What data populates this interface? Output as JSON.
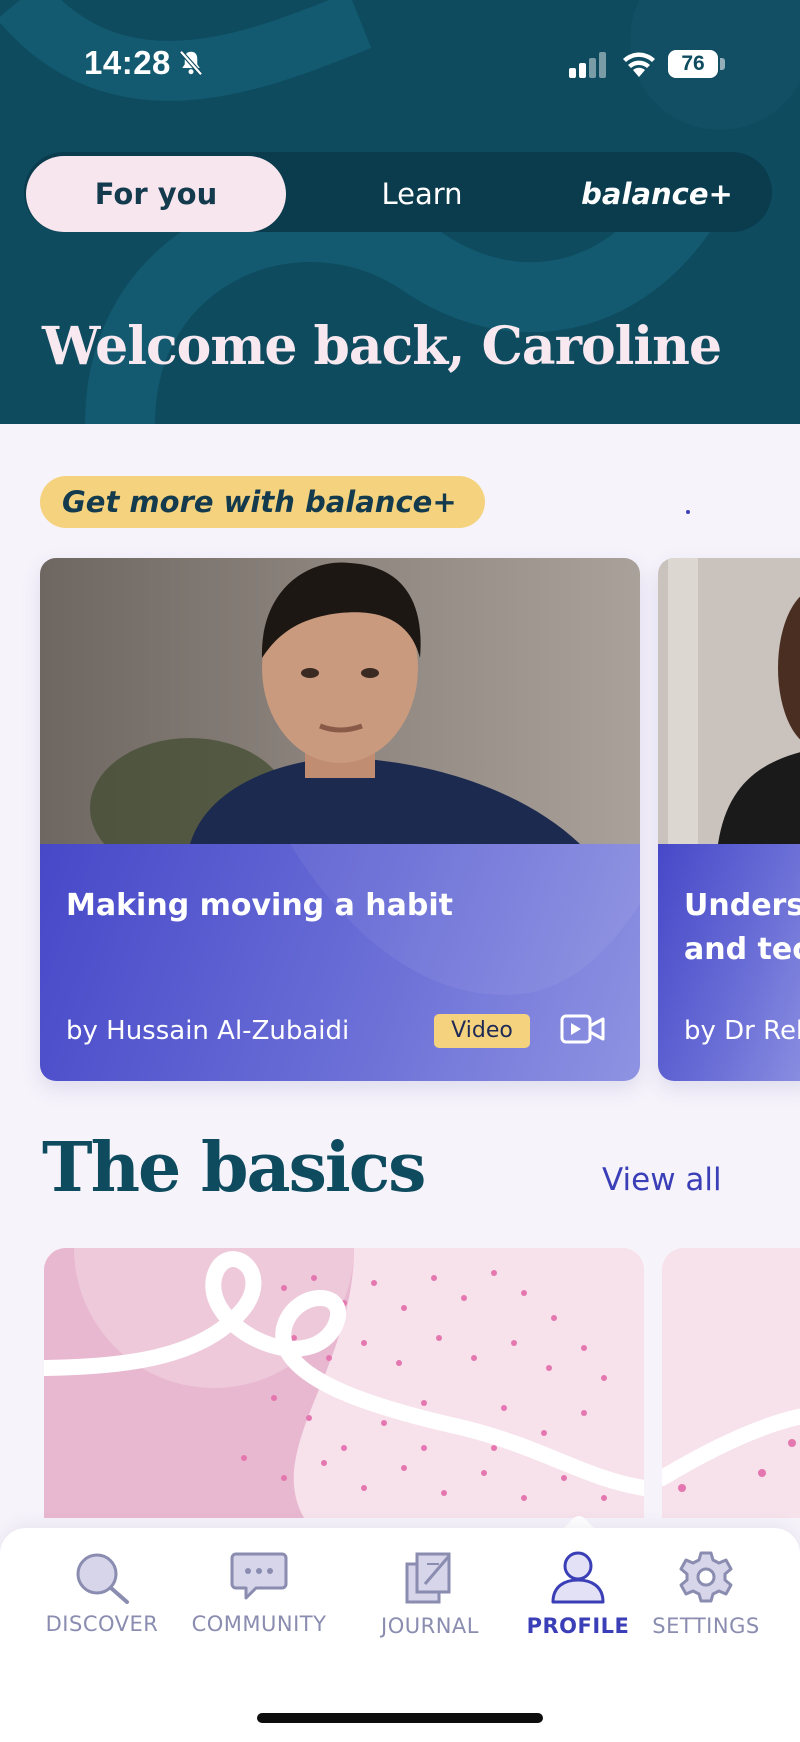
{
  "status_bar": {
    "time": "14:28",
    "battery": "76"
  },
  "tabs": [
    {
      "label": "For you",
      "active": true
    },
    {
      "label": "Learn",
      "active": false
    },
    {
      "label": "balance+",
      "active": false
    }
  ],
  "welcome": "Welcome back, Caroline",
  "promo": {
    "label": "Get more with balance+"
  },
  "featured_cards": [
    {
      "title": "Making moving a habit",
      "author": "by Hussain Al-Zubaidi",
      "badge": "Video"
    },
    {
      "title": "Underst… and tec…",
      "title_lines": [
        "Underst",
        "and tec"
      ],
      "author": "by Dr Reb"
    }
  ],
  "basics": {
    "title": "The basics",
    "view_all": "View all"
  },
  "bottom_nav": [
    {
      "label": "DISCOVER",
      "icon": "discover-icon",
      "active": false
    },
    {
      "label": "COMMUNITY",
      "icon": "community-icon",
      "active": false
    },
    {
      "label": "JOURNAL",
      "icon": "journal-icon",
      "active": false
    },
    {
      "label": "PROFILE",
      "icon": "profile-icon",
      "active": true
    },
    {
      "label": "SETTINGS",
      "icon": "settings-icon",
      "active": false
    }
  ],
  "colors": {
    "header_bg": "#0e4b5f",
    "accent": "#3b3fb7",
    "promo_bg": "#f4d27e",
    "page_bg": "#f6f3fb",
    "tab_active_bg": "#f7e6ee"
  }
}
